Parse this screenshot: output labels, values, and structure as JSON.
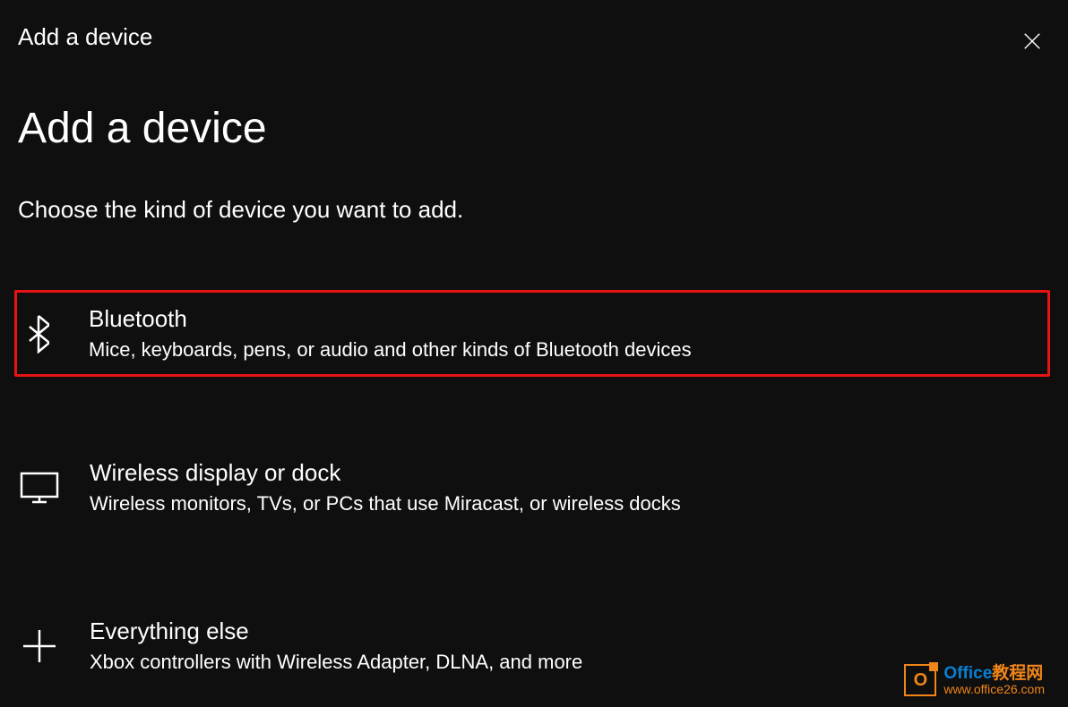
{
  "titlebar": {
    "title": "Add a device"
  },
  "heading": "Add a device",
  "subheading": "Choose the kind of device you want to add.",
  "options": [
    {
      "title": "Bluetooth",
      "desc": "Mice, keyboards, pens, or audio and other kinds of Bluetooth devices"
    },
    {
      "title": "Wireless display or dock",
      "desc": "Wireless monitors, TVs, or PCs that use Miracast, or wireless docks"
    },
    {
      "title": "Everything else",
      "desc": "Xbox controllers with Wireless Adapter, DLNA, and more"
    }
  ],
  "watermark": {
    "logo_letter": "O",
    "brand": "Office",
    "suffix": "教程网",
    "url": "www.office26.com"
  }
}
